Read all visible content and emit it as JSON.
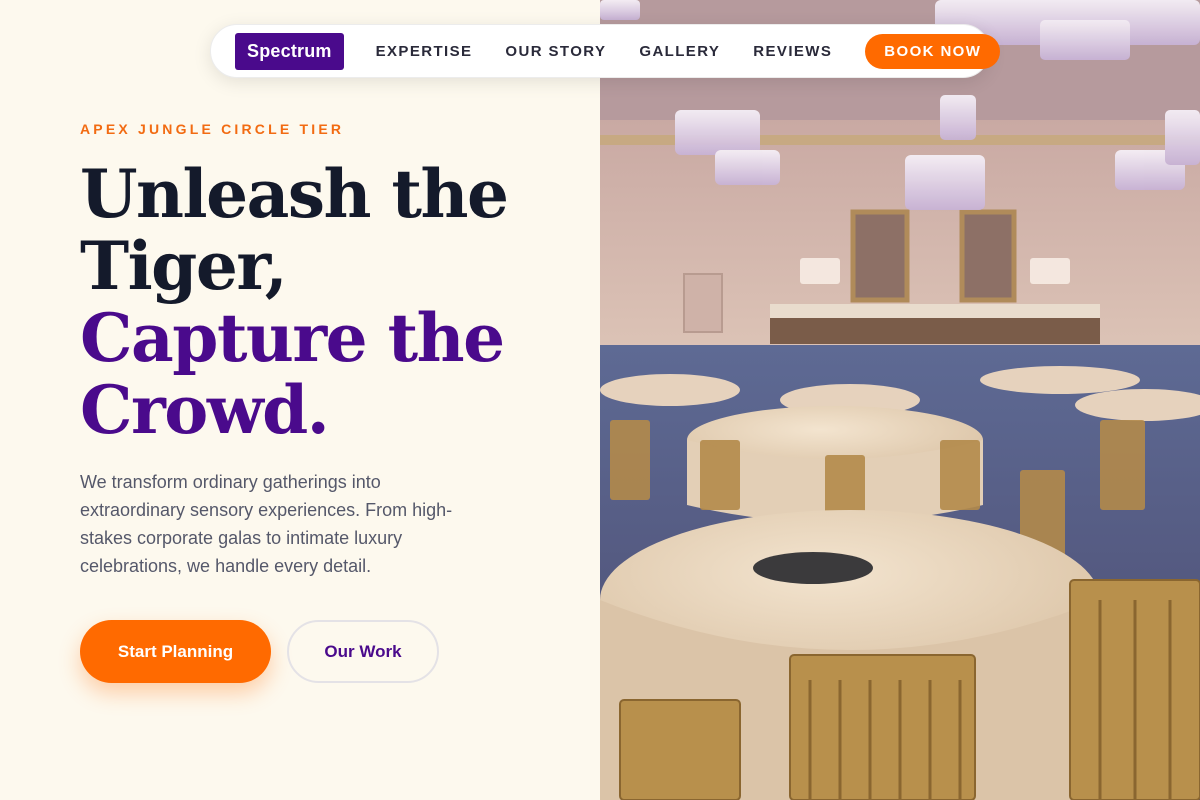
{
  "nav": {
    "brand": "Spectrum",
    "links": [
      "EXPERTISE",
      "OUR STORY",
      "GALLERY",
      "REVIEWS"
    ],
    "cta": "BOOK NOW"
  },
  "hero": {
    "eyebrow": "APEX JUNGLE CIRCLE TIER",
    "headline_line1": "Unleash the",
    "headline_line2": "Tiger,",
    "headline_line3": "Capture the",
    "headline_line4": "Crowd.",
    "lead": "We transform ordinary gatherings into extraordinary sensory experiences. From high-stakes corporate galas to intimate luxury celebrations, we handle every detail.",
    "primary_button": "Start Planning",
    "secondary_button": "Our Work"
  },
  "colors": {
    "background": "#fdf9ee",
    "accent_orange": "#ff6a00",
    "brand_purple": "#4a0a8c",
    "headline_dark": "#141a2b"
  },
  "image": {
    "subject": "ballroom-photo"
  }
}
